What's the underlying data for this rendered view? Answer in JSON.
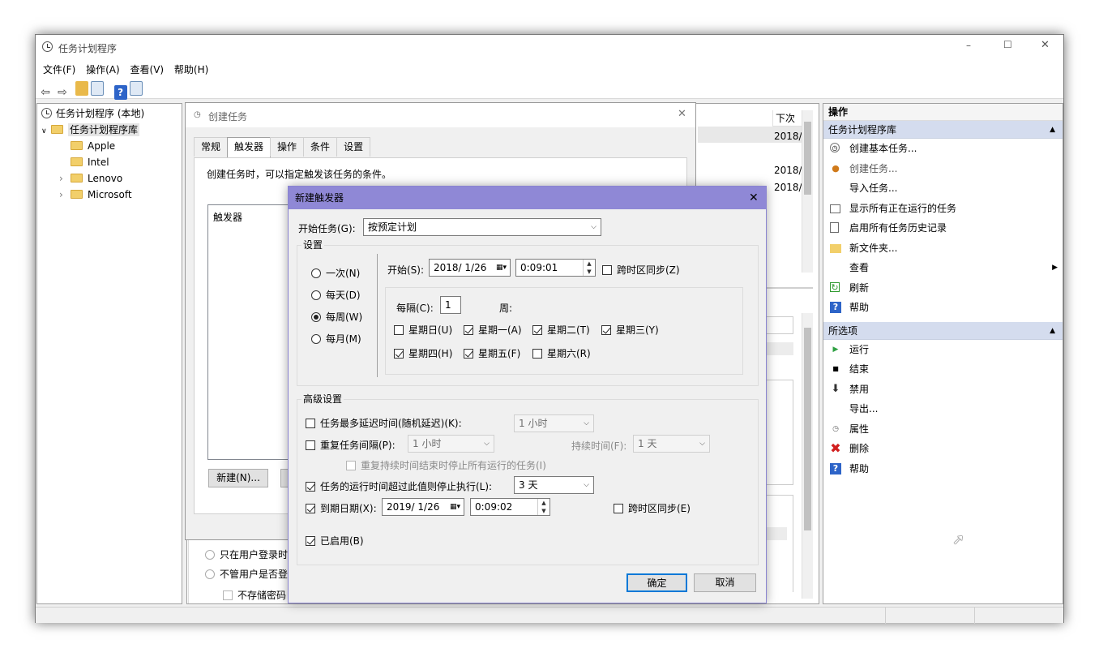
{
  "main_window": {
    "title": "任务计划程序",
    "controls": {
      "minimize": "–",
      "maximize": "☐",
      "close": "✕"
    }
  },
  "menu": [
    "文件(F)",
    "操作(A)",
    "查看(V)",
    "帮助(H)"
  ],
  "tree": {
    "root": "任务计划程序 (本地)",
    "library": "任务计划程序库",
    "folders": [
      "Apple",
      "Intel",
      "Lenovo",
      "Microsoft"
    ]
  },
  "middle": {
    "col_next_run": "下次运",
    "rows": [
      "2018/",
      "2018/",
      "2018/"
    ]
  },
  "actions": {
    "header": "操作",
    "library_section": "任务计划程序库",
    "library_items": [
      "创建基本任务...",
      "创建任务...",
      "导入任务...",
      "显示所有正在运行的任务",
      "启用所有任务历史记录",
      "新文件夹...",
      "查看",
      "刷新",
      "帮助"
    ],
    "selected_section": "所选项",
    "selected_items": [
      "运行",
      "结束",
      "禁用",
      "导出...",
      "属性",
      "删除",
      "帮助"
    ]
  },
  "create_task": {
    "title": "创建任务",
    "tabs": [
      "常规",
      "触发器",
      "操作",
      "条件",
      "设置"
    ],
    "description": "创建任务时，可以指定触发该任务的条件。",
    "list_header": "触发器",
    "new_button": "新建(N)...",
    "run_when_logged_on": "只在用户登录时",
    "run_whether": "不管用户是否登",
    "no_store_password": "不存储密码"
  },
  "new_trigger": {
    "title": "新建触发器",
    "begin_label": "开始任务(G):",
    "begin_value": "按预定计划",
    "settings_label": "设置",
    "schedule": [
      "一次(N)",
      "每天(D)",
      "每周(W)",
      "每月(M)"
    ],
    "start_label": "开始(S):",
    "start_date": "2018/ 1/26",
    "start_time": "0:09:01",
    "sync_tz": "跨时区同步(Z)",
    "recur_label": "每隔(C):",
    "recur_value": "1",
    "recur_unit": "周:",
    "days_row1": [
      {
        "label": "星期日(U)",
        "checked": false
      },
      {
        "label": "星期一(A)",
        "checked": true
      },
      {
        "label": "星期二(T)",
        "checked": true
      },
      {
        "label": "星期三(Y)",
        "checked": true
      }
    ],
    "days_row2": [
      {
        "label": "星期四(H)",
        "checked": true
      },
      {
        "label": "星期五(F)",
        "checked": true
      },
      {
        "label": "星期六(R)",
        "checked": false
      }
    ],
    "advanced_label": "高级设置",
    "delay_label": "任务最多延迟时间(随机延迟)(K):",
    "delay_value": "1 小时",
    "repeat_label": "重复任务间隔(P):",
    "repeat_value": "1 小时",
    "duration_label": "持续时间(F):",
    "duration_value": "1 天",
    "stop_all_label": "重复持续时间结束时停止所有运行的任务(I)",
    "stop_if_label": "任务的运行时间超过此值则停止执行(L):",
    "stop_if_value": "3 天",
    "expire_label": "到期日期(X):",
    "expire_date": "2019/ 1/26",
    "expire_time": "0:09:02",
    "expire_sync": "跨时区同步(E)",
    "enabled_label": "已启用(B)",
    "ok": "确定",
    "cancel": "取消"
  }
}
